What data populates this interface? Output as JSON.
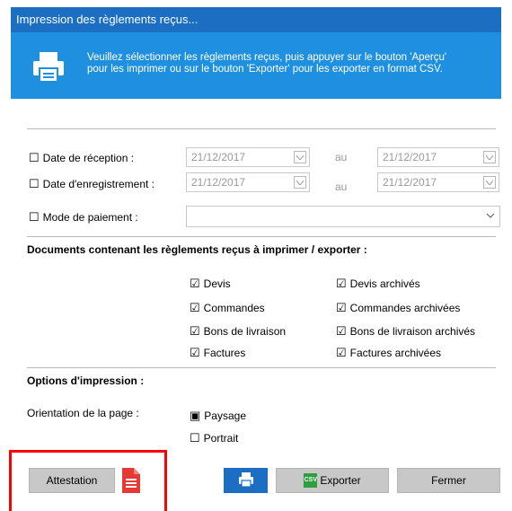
{
  "window": {
    "title": "Impression des règlements reçus..."
  },
  "banner": {
    "line1": "Veuillez sélectionner les règlements reçus, puis appuyer sur le bouton 'Aperçu'",
    "line2": "pour les imprimer ou sur le bouton 'Exporter' pour les exporter en format CSV.",
    "icon": "printer-icon"
  },
  "filters": {
    "reception": {
      "label": "Date de réception :",
      "from": "21/12/2017",
      "to_label": "au",
      "to": "21/12/2017"
    },
    "enregistrement": {
      "label": "Date d'enregistrement :",
      "from": "21/12/2017",
      "to_label": "au",
      "to": "21/12/2017"
    },
    "mode": {
      "label": "Mode de paiement :",
      "value": ""
    }
  },
  "documents": {
    "title": "Documents contenant les règlements reçus à imprimer / exporter :",
    "left": [
      "Devis",
      "Commandes",
      "Bons de livraison",
      "Factures"
    ],
    "right": [
      "Devis archivés",
      "Commandes archivées",
      "Bons de livraison archivés",
      "Factures archivées"
    ]
  },
  "options": {
    "title": "Options d'impression :",
    "orientation_label": "Orientation de la page :",
    "paysage": "Paysage",
    "portrait": "Portrait"
  },
  "buttons": {
    "attestation": "Attestation",
    "exporter": "Exporter",
    "csv_badge": "CSV",
    "fermer": "Fermer"
  },
  "colors": {
    "title_bar": "#1b6ec2",
    "banner": "#1e90df",
    "highlight": "#ff0000",
    "pdf_icon": "#e53935",
    "csv_icon": "#2e9e3e"
  }
}
